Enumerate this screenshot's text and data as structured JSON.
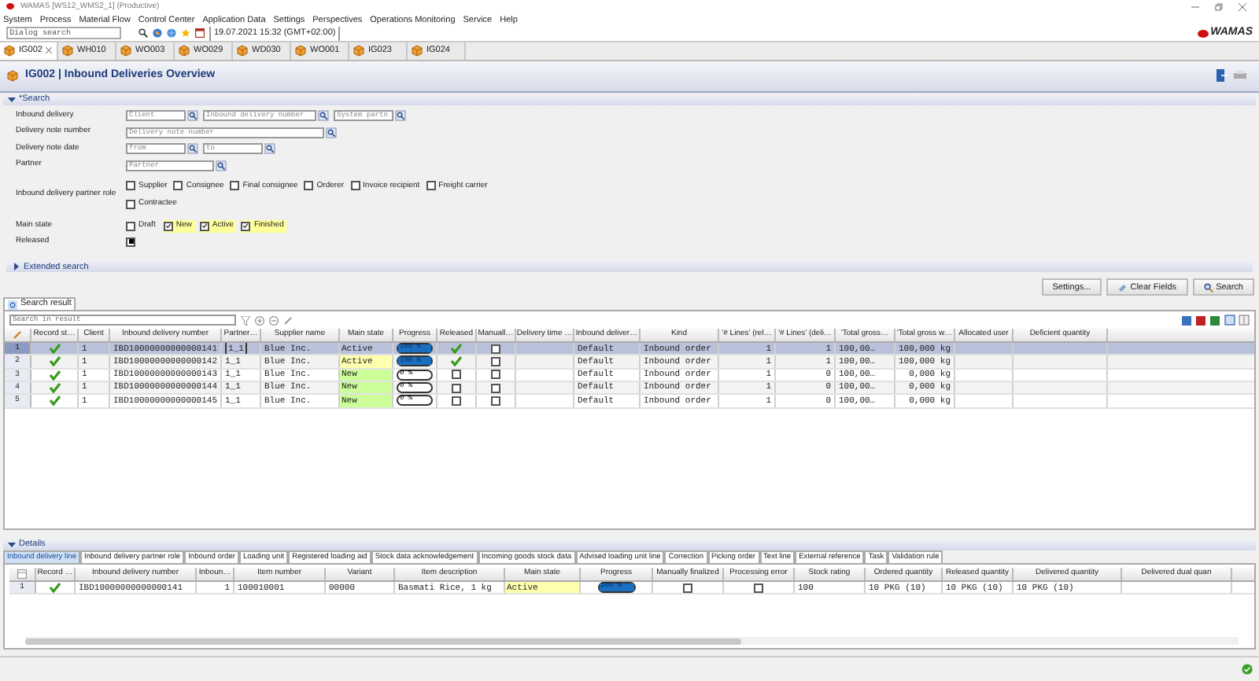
{
  "window": {
    "title": "WAMAS [WS12_WMS2_1] (Productive)"
  },
  "menu": [
    "System",
    "Process",
    "Material Flow",
    "Control Center",
    "Application Data",
    "Settings",
    "Perspectives",
    "Operations Monitoring",
    "Service",
    "Help"
  ],
  "toolbar": {
    "placeholder": "Dialog search",
    "datetime": "19.07.2021 15:32 (GMT+02:00)"
  },
  "brand": "WAMAS",
  "tabs": [
    {
      "label": "IG002",
      "selected": true
    },
    {
      "label": "WH010",
      "selected": false
    },
    {
      "label": "WO003",
      "selected": false
    },
    {
      "label": "WO029",
      "selected": false
    },
    {
      "label": "WD030",
      "selected": false
    },
    {
      "label": "WO001",
      "selected": false
    },
    {
      "label": "IG023",
      "selected": false
    },
    {
      "label": "IG024",
      "selected": false
    }
  ],
  "page": {
    "title": "IG002 | Inbound Deliveries Overview"
  },
  "search": {
    "title": "*Search",
    "expanded": true,
    "rows": [
      {
        "label": "Inbound delivery",
        "inputs": [
          {
            "placeholder": "Client"
          },
          {
            "placeholder": "Inbound delivery number"
          },
          {
            "placeholder": "System partn"
          }
        ]
      },
      {
        "label": "Delivery note number",
        "inputs": [
          {
            "placeholder": "Delivery note number"
          }
        ]
      },
      {
        "label": "Delivery note date",
        "inputs": [
          {
            "placeholder": "from"
          },
          {
            "placeholder": "to"
          }
        ]
      },
      {
        "label": "Partner",
        "inputs": [
          {
            "placeholder": "Partner"
          }
        ]
      }
    ],
    "partner_role": {
      "label": "Inbound delivery partner role",
      "options": [
        {
          "label": "Supplier",
          "checked": false
        },
        {
          "label": "Consignee",
          "checked": false
        },
        {
          "label": "Final consignee",
          "checked": false
        },
        {
          "label": "Orderer",
          "checked": false
        },
        {
          "label": "Invoice recipient",
          "checked": false
        },
        {
          "label": "Freight carrier",
          "checked": false
        },
        {
          "label": "Contractee",
          "checked": false
        }
      ]
    },
    "main_state": {
      "label": "Main state",
      "options": [
        {
          "label": "Draft",
          "checked": false
        },
        {
          "label": "New",
          "checked": true
        },
        {
          "label": "Active",
          "checked": true
        },
        {
          "label": "Finished",
          "checked": true
        }
      ]
    },
    "released": {
      "label": "Released",
      "indeterminate": true
    }
  },
  "extended_search": {
    "title": "Extended search",
    "expanded": false
  },
  "buttons": [
    {
      "label": "Settings..."
    },
    {
      "label": "Clear Fields"
    },
    {
      "label": "Search"
    }
  ],
  "result": {
    "tab": "Search result",
    "filter_placeholder": "Search in result",
    "columns": [
      "Record st…",
      "Client",
      "Inbound delivery number",
      "Partner…",
      "Supplier name",
      "Main state",
      "Progress",
      "Released",
      "Manuall…",
      "Delivery time …",
      "Inbound deliver…",
      "Kind",
      "'# Lines' (rel…",
      "'# Lines' (deli…",
      "'Total gross…",
      "'Total gross w…",
      "Allocated user",
      "Deficient quantity"
    ],
    "rows": [
      {
        "num": "1",
        "selected": true,
        "cells": [
          {
            "kind": "ok"
          },
          {
            "kind": "text",
            "text": "1"
          },
          {
            "kind": "text",
            "text": "IBD10000000000000141"
          },
          {
            "kind": "text",
            "text": "1_1",
            "focused": true
          },
          {
            "kind": "text",
            "text": "Blue Inc."
          },
          {
            "kind": "state",
            "text": "Active"
          },
          {
            "kind": "progress",
            "level": 1,
            "text": "100 %"
          },
          {
            "kind": "ok"
          },
          {
            "kind": "checkbox",
            "checked": false
          },
          {
            "kind": "empty"
          },
          {
            "kind": "text",
            "text": "Default"
          },
          {
            "kind": "text",
            "text": "Inbound order"
          },
          {
            "kind": "num",
            "text": "1"
          },
          {
            "kind": "num",
            "text": "1"
          },
          {
            "kind": "text",
            "text": "100,00…"
          },
          {
            "kind": "num",
            "text": "100,000 kg"
          },
          {
            "kind": "empty"
          },
          {
            "kind": "empty"
          }
        ]
      },
      {
        "num": "2",
        "selected": false,
        "cells": [
          {
            "kind": "ok"
          },
          {
            "kind": "text",
            "text": "1"
          },
          {
            "kind": "text",
            "text": "IBD10000000000000142"
          },
          {
            "kind": "text",
            "text": "1_1"
          },
          {
            "kind": "text",
            "text": "Blue Inc."
          },
          {
            "kind": "state",
            "text": "Active",
            "color": "#ffffb0"
          },
          {
            "kind": "progress",
            "level": 1,
            "text": "100 %"
          },
          {
            "kind": "ok"
          },
          {
            "kind": "checkbox",
            "checked": false
          },
          {
            "kind": "empty"
          },
          {
            "kind": "text",
            "text": "Default"
          },
          {
            "kind": "text",
            "text": "Inbound order"
          },
          {
            "kind": "num",
            "text": "1"
          },
          {
            "kind": "num",
            "text": "1"
          },
          {
            "kind": "text",
            "text": "100,00…"
          },
          {
            "kind": "num",
            "text": "100,000 kg"
          },
          {
            "kind": "empty"
          },
          {
            "kind": "empty"
          }
        ]
      },
      {
        "num": "3",
        "selected": false,
        "cells": [
          {
            "kind": "ok"
          },
          {
            "kind": "text",
            "text": "1"
          },
          {
            "kind": "text",
            "text": "IBD10000000000000143"
          },
          {
            "kind": "text",
            "text": "1_1"
          },
          {
            "kind": "text",
            "text": "Blue Inc."
          },
          {
            "kind": "state",
            "text": "New",
            "color": "#ccff99"
          },
          {
            "kind": "progress",
            "level": 0,
            "text": "0 %"
          },
          {
            "kind": "checkbox",
            "checked": false
          },
          {
            "kind": "checkbox",
            "checked": false
          },
          {
            "kind": "empty"
          },
          {
            "kind": "text",
            "text": "Default"
          },
          {
            "kind": "text",
            "text": "Inbound order"
          },
          {
            "kind": "num",
            "text": "1"
          },
          {
            "kind": "num",
            "text": "0"
          },
          {
            "kind": "text",
            "text": "100,00…"
          },
          {
            "kind": "num",
            "text": "0,000 kg"
          },
          {
            "kind": "empty"
          },
          {
            "kind": "empty"
          }
        ]
      },
      {
        "num": "4",
        "selected": false,
        "cells": [
          {
            "kind": "ok"
          },
          {
            "kind": "text",
            "text": "1"
          },
          {
            "kind": "text",
            "text": "IBD10000000000000144"
          },
          {
            "kind": "text",
            "text": "1_1"
          },
          {
            "kind": "text",
            "text": "Blue Inc."
          },
          {
            "kind": "state",
            "text": "New",
            "color": "#ccff99"
          },
          {
            "kind": "progress",
            "level": 0,
            "text": "0 %"
          },
          {
            "kind": "checkbox",
            "checked": false
          },
          {
            "kind": "checkbox",
            "checked": false
          },
          {
            "kind": "empty"
          },
          {
            "kind": "text",
            "text": "Default"
          },
          {
            "kind": "text",
            "text": "Inbound order"
          },
          {
            "kind": "num",
            "text": "1"
          },
          {
            "kind": "num",
            "text": "0"
          },
          {
            "kind": "text",
            "text": "100,00…"
          },
          {
            "kind": "num",
            "text": "0,000 kg"
          },
          {
            "kind": "empty"
          },
          {
            "kind": "empty"
          }
        ]
      },
      {
        "num": "5",
        "selected": false,
        "cells": [
          {
            "kind": "ok"
          },
          {
            "kind": "text",
            "text": "1"
          },
          {
            "kind": "text",
            "text": "IBD10000000000000145"
          },
          {
            "kind": "text",
            "text": "1_1"
          },
          {
            "kind": "text",
            "text": "Blue Inc."
          },
          {
            "kind": "state",
            "text": "New",
            "color": "#ccff99"
          },
          {
            "kind": "progress",
            "level": 0,
            "text": "0 %"
          },
          {
            "kind": "checkbox",
            "checked": false
          },
          {
            "kind": "checkbox",
            "checked": false
          },
          {
            "kind": "empty"
          },
          {
            "kind": "text",
            "text": "Default"
          },
          {
            "kind": "text",
            "text": "Inbound order"
          },
          {
            "kind": "num",
            "text": "1"
          },
          {
            "kind": "num",
            "text": "0"
          },
          {
            "kind": "text",
            "text": "100,00…"
          },
          {
            "kind": "num",
            "text": "0,000 kg"
          },
          {
            "kind": "empty"
          },
          {
            "kind": "empty"
          }
        ]
      }
    ]
  },
  "details": {
    "title": "Details",
    "expanded": true,
    "tabs": [
      {
        "label": "Inbound delivery line",
        "selected": true
      },
      {
        "label": "Inbound delivery partner role",
        "selected": false
      },
      {
        "label": "Inbound order",
        "selected": false
      },
      {
        "label": "Loading unit",
        "selected": false
      },
      {
        "label": "Registered loading aid",
        "selected": false
      },
      {
        "label": "Stock data acknowledgement",
        "selected": false
      },
      {
        "label": "Incoming goods stock data",
        "selected": false
      },
      {
        "label": "Advised loading unit line",
        "selected": false
      },
      {
        "label": "Correction",
        "selected": false
      },
      {
        "label": "Picking order",
        "selected": false
      },
      {
        "label": "Text line",
        "selected": false
      },
      {
        "label": "External reference",
        "selected": false
      },
      {
        "label": "Task",
        "selected": false
      },
      {
        "label": "Validation rule",
        "selected": false
      }
    ],
    "columns": [
      "Record …",
      "Inbound delivery number",
      "Inboun…",
      "Item number",
      "Variant",
      "Item description",
      "Main state",
      "Progress",
      "Manually finalized",
      "Processing error",
      "Stock rating",
      "Ordered quantity",
      "Released quantity",
      "Delivered quantity",
      "Delivered dual quan"
    ],
    "rows": [
      {
        "num": "1",
        "selected": false,
        "cells": [
          {
            "kind": "ok"
          },
          {
            "kind": "text",
            "text": "IBD10000000000000141"
          },
          {
            "kind": "num",
            "text": "1"
          },
          {
            "kind": "text",
            "text": "100010001"
          },
          {
            "kind": "text",
            "text": "00000"
          },
          {
            "kind": "text",
            "text": "Basmati Rice, 1 kg"
          },
          {
            "kind": "state",
            "text": "Active",
            "color": "#ffffb0"
          },
          {
            "kind": "progress",
            "level": 1,
            "text": "100 %"
          },
          {
            "kind": "checkbox",
            "checked": false
          },
          {
            "kind": "checkbox",
            "checked": false
          },
          {
            "kind": "text",
            "text": "100"
          },
          {
            "kind": "text",
            "text": "10 PKG (10)"
          },
          {
            "kind": "text",
            "text": "10 PKG (10)"
          },
          {
            "kind": "text",
            "text": "10 PKG (10)"
          },
          {
            "kind": "empty"
          }
        ]
      }
    ]
  }
}
